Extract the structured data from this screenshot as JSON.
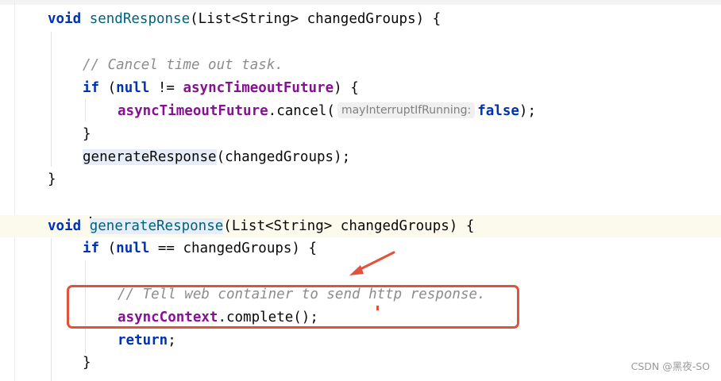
{
  "code": {
    "line1": {
      "kw": "void",
      "method": "sendResponse",
      "args": "(List<String> changedGroups) {"
    },
    "line2": {
      "comment": "// Cancel time out task."
    },
    "line3": {
      "kw_if": "if",
      "open": " (",
      "kw_null": "null",
      "op": " != ",
      "field": "asyncTimeoutFuture",
      "close": ") {"
    },
    "line4": {
      "field": "asyncTimeoutFuture",
      "call": ".cancel(",
      "hint": "mayInterruptIfRunning:",
      "kw_false": "false",
      "end": ");"
    },
    "line5": {
      "brace": "}"
    },
    "line6": {
      "call": "generateResponse",
      "args": "(changedGroups);"
    },
    "line7": {
      "brace": "}"
    },
    "line8": {
      "kw": "void",
      "method_first": "g",
      "method_rest": "enerateResponse",
      "args": "(List<String> changedGroups) {"
    },
    "line9": {
      "kw_if": "if",
      "open": " (",
      "kw_null": "null",
      "rest": " == changedGroups) {"
    },
    "line10": {
      "comment": "// Tell web container to send http response."
    },
    "line11": {
      "field": "asyncContext",
      "rest": ".complete();"
    },
    "line12": {
      "kw_return": "return",
      "end": ";"
    },
    "line13": {
      "brace": "}"
    }
  },
  "annotation": {
    "color": "#e0533a"
  },
  "watermark": "CSDN @黑夜-SO"
}
